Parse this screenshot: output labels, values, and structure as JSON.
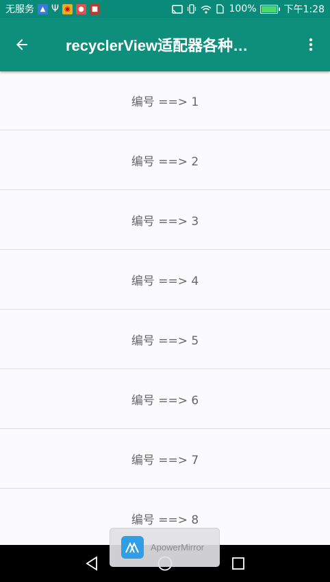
{
  "status_bar": {
    "carrier": "无服务",
    "battery_percent": "100%",
    "time": "下午1:28",
    "battery_level": 1.0
  },
  "toolbar": {
    "title": "recyclerView适配器各种…",
    "back_icon": "arrow-back-icon",
    "menu_icon": "more-vert-icon"
  },
  "list": {
    "items": [
      {
        "label": "编号 ==> 1"
      },
      {
        "label": "编号 ==> 2"
      },
      {
        "label": "编号 ==> 3"
      },
      {
        "label": "编号 ==> 4"
      },
      {
        "label": "编号 ==> 5"
      },
      {
        "label": "编号 ==> 6"
      },
      {
        "label": "编号 ==> 7"
      },
      {
        "label": "编号 ==> 8"
      }
    ]
  },
  "overlay": {
    "app_name": "ApowerMirror"
  },
  "colors": {
    "primary": "#0d8f7c",
    "background": "#fbfbfe",
    "divider": "#d9dde0",
    "item_text": "#666666"
  }
}
